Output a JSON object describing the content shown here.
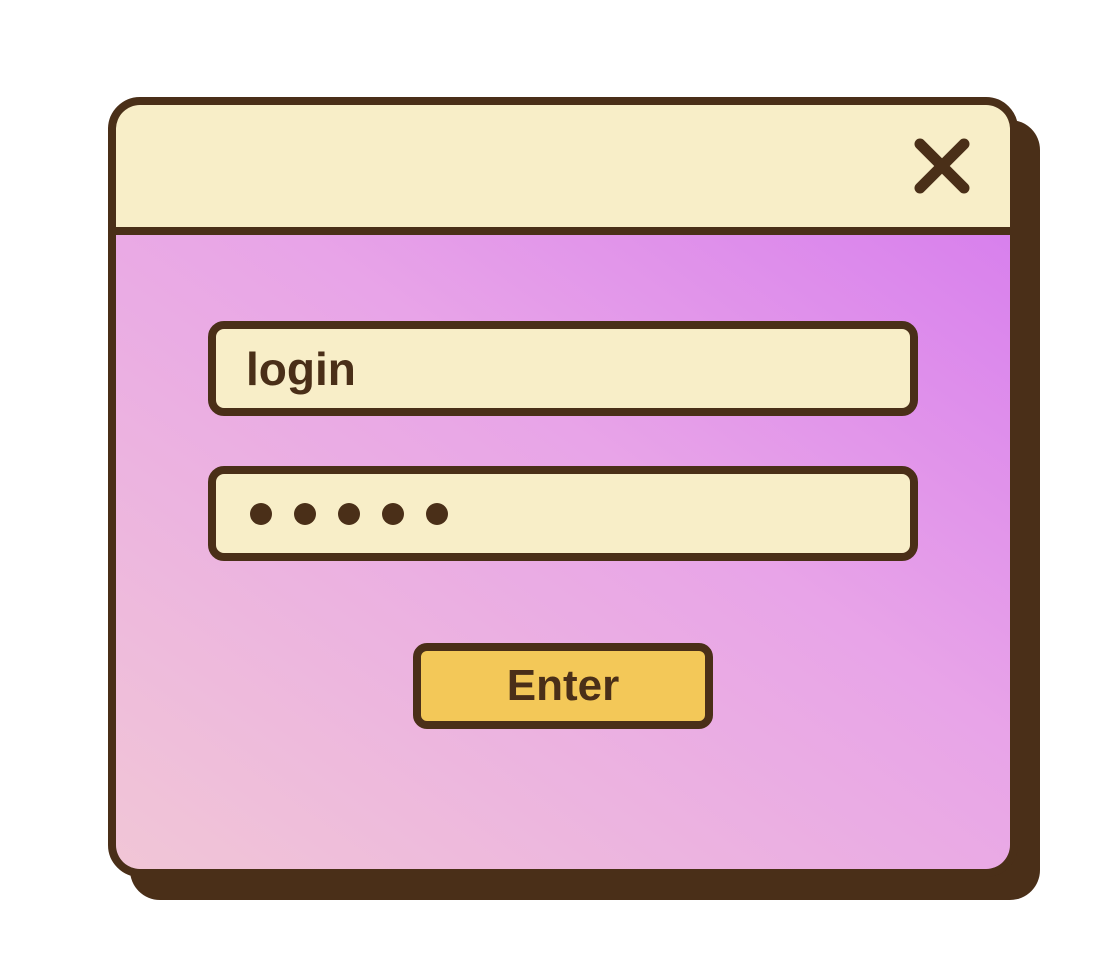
{
  "window": {
    "close_icon": "close-icon"
  },
  "form": {
    "login": {
      "placeholder": "login",
      "value": ""
    },
    "password": {
      "masked_value": "•••••",
      "dot_count": 5
    },
    "submit_label": "Enter"
  },
  "colors": {
    "outline": "#4a2f18",
    "titlebar_bg": "#f8eec8",
    "field_bg": "#f8eec8",
    "button_bg": "#f3c858",
    "body_gradient_start": "#d880ed",
    "body_gradient_end": "#f1c6d6"
  }
}
